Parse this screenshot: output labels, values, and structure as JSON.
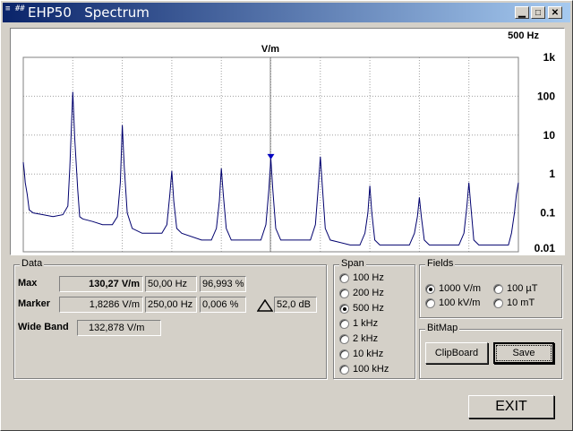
{
  "window": {
    "title": "EHP50   Spectrum",
    "icon_text": "≡ ##"
  },
  "chart": {
    "span_label": "500 Hz",
    "unit_label": "V/m",
    "y_ticks": [
      "1k",
      "100",
      "10",
      "1",
      "0.1",
      "0.01"
    ]
  },
  "chart_data": {
    "type": "line",
    "ylabel": "V/m",
    "yscale": "log",
    "ylim": [
      0.01,
      1000
    ],
    "xlim": [
      0,
      500
    ],
    "series": [
      {
        "x": [
          0,
          1,
          2,
          4,
          6,
          10,
          20,
          30,
          40,
          45,
          47,
          50,
          52,
          55,
          57,
          60,
          70,
          80,
          90,
          95,
          98,
          100,
          102,
          105,
          110,
          120,
          140,
          145,
          148,
          150,
          152,
          155,
          160,
          180,
          190,
          195,
          198,
          200,
          202,
          205,
          210,
          230,
          240,
          245,
          248,
          250,
          252,
          255,
          260,
          280,
          290,
          295,
          298,
          300,
          302,
          305,
          310,
          330,
          340,
          345,
          348,
          350,
          352,
          355,
          360,
          380,
          390,
          395,
          398,
          400,
          402,
          405,
          410,
          430,
          440,
          445,
          448,
          450,
          452,
          455,
          460,
          480,
          490,
          493,
          496,
          498,
          500
        ],
        "y": [
          2,
          1.2,
          0.6,
          0.3,
          0.12,
          0.1,
          0.09,
          0.08,
          0.09,
          0.15,
          1.5,
          130,
          8,
          0.4,
          0.08,
          0.07,
          0.06,
          0.05,
          0.05,
          0.08,
          0.6,
          18,
          1.5,
          0.1,
          0.04,
          0.03,
          0.03,
          0.05,
          0.3,
          1.2,
          0.2,
          0.04,
          0.03,
          0.02,
          0.02,
          0.04,
          0.2,
          1.4,
          0.3,
          0.04,
          0.02,
          0.02,
          0.02,
          0.05,
          0.4,
          2.5,
          0.4,
          0.04,
          0.02,
          0.02,
          0.02,
          0.05,
          0.5,
          2.8,
          0.5,
          0.04,
          0.02,
          0.015,
          0.015,
          0.03,
          0.1,
          0.5,
          0.1,
          0.02,
          0.015,
          0.015,
          0.015,
          0.03,
          0.08,
          0.25,
          0.08,
          0.02,
          0.015,
          0.015,
          0.015,
          0.03,
          0.15,
          0.6,
          0.15,
          0.02,
          0.015,
          0.015,
          0.015,
          0.03,
          0.1,
          0.3,
          0.6
        ]
      }
    ]
  },
  "data_group": {
    "label": "Data",
    "max_label": "Max",
    "max_value": "130,27 V/m",
    "max_freq": "50,00 Hz",
    "max_pct": "96,993 %",
    "marker_label": "Marker",
    "marker_value": "1,8286 V/m",
    "marker_freq": "250,00 Hz",
    "marker_pct": "0,006 %",
    "delta_value": "52,0 dB",
    "wideband_label": "Wide Band",
    "wideband_value": "132,878 V/m"
  },
  "span_group": {
    "label": "Span",
    "options": [
      "100 Hz",
      "200 Hz",
      "500 Hz",
      "1 kHz",
      "2 kHz",
      "10  kHz",
      "100 kHz"
    ],
    "selected": "500 Hz"
  },
  "fields_group": {
    "label": "Fields",
    "opt1": "1000 V/m",
    "opt2": "100 µT",
    "opt3": "100 kV/m",
    "opt4": "10 mT",
    "selected": "1000 V/m"
  },
  "bitmap_group": {
    "label": "BitMap",
    "clipboard_label": "ClipBoard",
    "save_label": "Save"
  },
  "exit_label": "EXIT",
  "colors": {
    "trace": "#00006e",
    "grid": "#a0a0a0",
    "title_start": "#0a246a",
    "title_end": "#a6caf0"
  }
}
